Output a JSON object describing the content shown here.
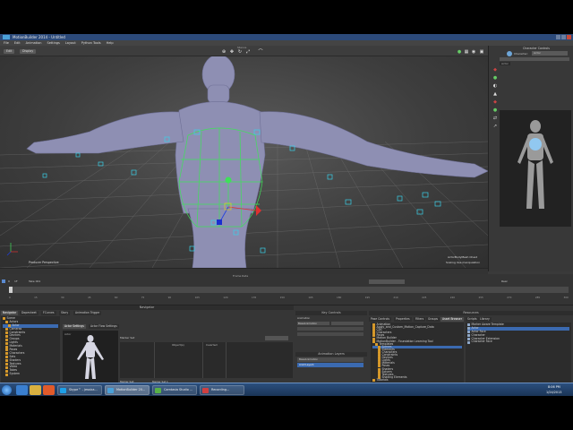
{
  "window": {
    "title": "MotionBuilder 2014 - Untitled"
  },
  "menu": [
    "File",
    "Edit",
    "Animation",
    "Settings",
    "Layout",
    "Python Tools",
    "Help"
  ],
  "toolbar": {
    "view_label": "Producer Perspective",
    "buttons": [
      "Edit",
      "Display"
    ],
    "camera_label": "Stance"
  },
  "viewport": {
    "camera_name": "Producer Perspective",
    "hud_top_right": "ActorBodyMesh Chest",
    "hud_sub": "Scaling Use manipulation"
  },
  "character_controls": {
    "title": "Character Controls",
    "character_label": "Character:",
    "character_value": "Actor",
    "tab": "Actor"
  },
  "timeline": {
    "start": "0",
    "end": "1F",
    "current": "Take 001",
    "ticks": [
      "0",
      "15",
      "30",
      "45",
      "60",
      "75",
      "90",
      "105",
      "120",
      "135",
      "150",
      "165",
      "180",
      "195",
      "210",
      "225",
      "240",
      "255",
      "270",
      "285",
      "300"
    ],
    "playback": "Real",
    "frame_label": "Frame Rate"
  },
  "navigator": {
    "title": "Navigator",
    "tabs": [
      "Navigator",
      "Dopesheet",
      "FCurves",
      "Story",
      "Animation Trigger"
    ],
    "subtabs": [
      "Actor Settings",
      "Actor Flow Settings"
    ],
    "tree": [
      "Scene",
      "Actors",
      "Actor",
      "Cameras",
      "Constraints",
      "Devices",
      "Groups",
      "Lights",
      "Materials",
      "Poses",
      "Characters",
      "Sets",
      "Shaders",
      "Textures",
      "Video",
      "Takes",
      "System"
    ],
    "preview_label": "Actor",
    "marker_set_label": "Marker Set",
    "columns": [
      "Object(s)",
      "Inverted"
    ],
    "footer_label": "Marker Set:",
    "footer_value": "Marker Set 1"
  },
  "key_controls": {
    "title": "Key Controls",
    "animation_label": "Animation",
    "layer_label": "BaseAnimation",
    "filter_label": "Filter",
    "transport_label": "Transport"
  },
  "animation_layers": {
    "title": "Animation Layers",
    "layers": [
      "BaseAnimation",
      "AnimLayer1"
    ]
  },
  "resources": {
    "title": "Resources",
    "tabs": [
      "Pose Controls",
      "Properties",
      "Filters",
      "Groups",
      "Asset Browser",
      "Scripts",
      "Library"
    ],
    "tree": [
      "Animation",
      "Apply_and_Custom_Motion_Capture_Data",
      "CDC",
      "Characters",
      "Poses",
      "Motion Builder",
      "MotionBuilder - Foundation Learning Tool",
      "Templates",
      "Scenes",
      "Elements",
      "Characters",
      "Constraints",
      "Devices",
      "Lights",
      "Materials",
      "Poses",
      "Shaders",
      "Solvers",
      "Textures",
      "Shading Elements",
      "Tutorials"
    ],
    "right_list": [
      "Marker Aware Template",
      "Actor",
      "Actor Face",
      "Character",
      "Character Extension",
      "Character Face"
    ]
  },
  "taskbar": {
    "tasks": [
      "Skype™ - jessica...",
      "MotionBuilder 20...",
      "Camtasia Studio ...",
      "Recording..."
    ],
    "time": "8:06 PM",
    "date": "1/24/2013"
  }
}
